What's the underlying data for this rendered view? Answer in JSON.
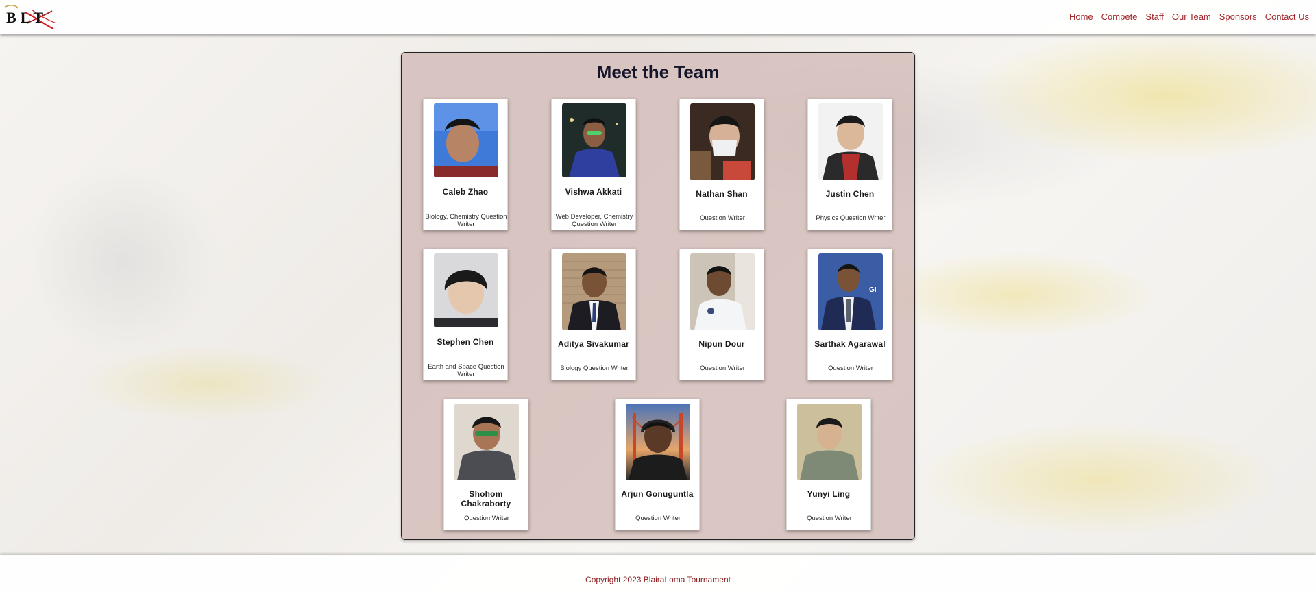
{
  "header": {
    "logo_text": "BLT",
    "nav": [
      "Home",
      "Compete",
      "Staff",
      "Our Team",
      "Sponsors",
      "Contact Us"
    ]
  },
  "page": {
    "title": "Meet the Team"
  },
  "team": [
    {
      "name": "Caleb Zhao",
      "role": "Biology, Chemistry Question Writer"
    },
    {
      "name": "Vishwa Akkati",
      "role": "Web Developer, Chemistry Question Writer"
    },
    {
      "name": "Nathan Shan",
      "role": "Question Writer"
    },
    {
      "name": "Justin Chen",
      "role": "Physics Question Writer"
    },
    {
      "name": "Stephen Chen",
      "role": "Earth and Space Question Writer"
    },
    {
      "name": "Aditya Sivakumar",
      "role": "Biology Question Writer"
    },
    {
      "name": "Nipun Dour",
      "role": "Question Writer"
    },
    {
      "name": "Sarthak Agarawal",
      "role": "Question Writer"
    },
    {
      "name": "Shohom Chakraborty",
      "role": "Question Writer"
    },
    {
      "name": "Arjun Gonuguntla",
      "role": "Question Writer"
    },
    {
      "name": "Yunyi Ling",
      "role": "Question Writer"
    }
  ],
  "footer": {
    "copyright": "Copyright 2023 BlairaLoma Tournament"
  },
  "colors": {
    "nav_link": "#a3262a",
    "footer_text": "#8b2020",
    "title": "#14142b",
    "panel_bg": "#ceb4b0"
  }
}
